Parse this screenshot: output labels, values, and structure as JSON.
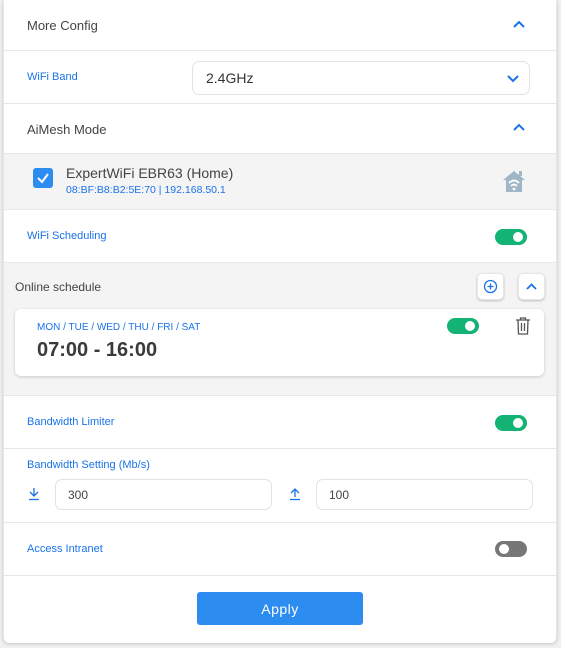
{
  "more_config": {
    "title": "More Config",
    "icon": "chevron-up-icon"
  },
  "wifi_band": {
    "label": "WiFi Band",
    "value": "2.4GHz",
    "icon": "chevron-down-icon"
  },
  "aimesh": {
    "title": "AiMesh Mode",
    "icon": "chevron-up-icon",
    "device": {
      "name": "ExpertWiFi EBR63 (Home)",
      "details": "08:BF:B8:B2:5E:70 | 192.168.50.1",
      "checked": true,
      "icon": "home-wifi-icon"
    }
  },
  "wifi_scheduling": {
    "label": "WiFi Scheduling",
    "enabled": true
  },
  "online_schedule": {
    "title": "Online schedule",
    "add_icon": "plus-circle-icon",
    "collapse_icon": "chevron-up-icon",
    "schedules": [
      {
        "days": "MON / TUE / WED / THU / FRI / SAT",
        "time": "07:00 - 16:00",
        "enabled": true,
        "delete_icon": "trash-icon"
      }
    ]
  },
  "bandwidth_limiter": {
    "label": "Bandwidth Limiter",
    "enabled": true
  },
  "bandwidth_setting": {
    "label": "Bandwidth Setting (Mb/s)",
    "download": {
      "icon": "download-icon",
      "value": "300"
    },
    "upload": {
      "icon": "upload-icon",
      "value": "100"
    }
  },
  "access_intranet": {
    "label": "Access Intranet",
    "enabled": false
  },
  "colors": {
    "accent": "#2d8cf0",
    "toggle_on": "#12b373",
    "toggle_off": "#777777"
  },
  "apply_label": "Apply"
}
